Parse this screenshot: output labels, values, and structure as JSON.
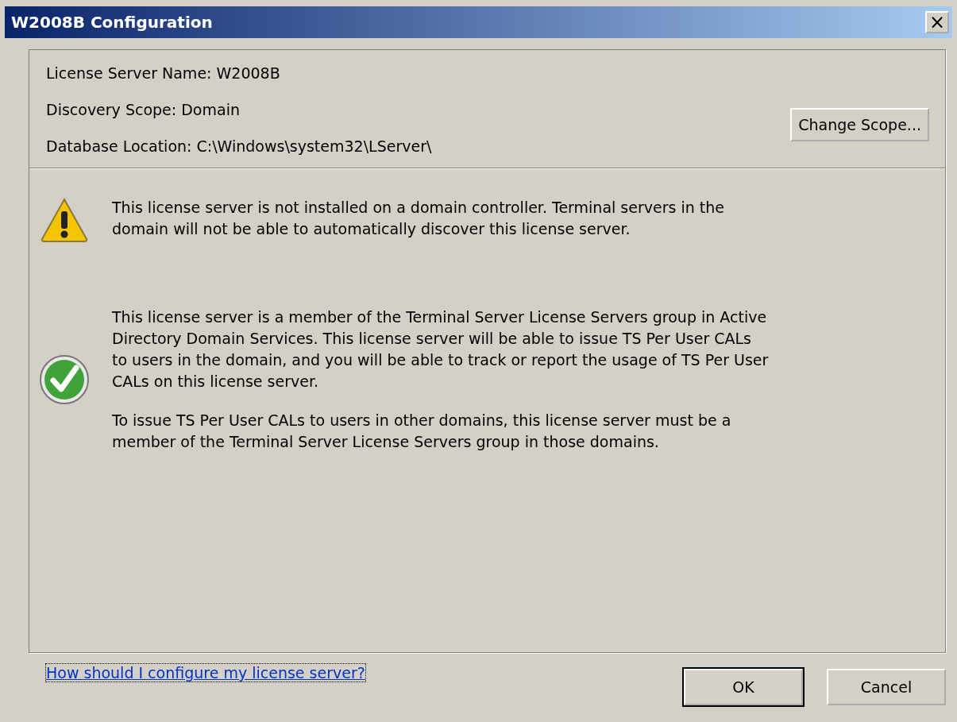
{
  "window": {
    "title": "W2008B Configuration",
    "close": "×"
  },
  "info": [
    {
      "text": "License Server Name: W2008B"
    },
    {
      "text": "Discovery Scope: Domain"
    },
    {
      "text": "Database Location: C:\\Windows\\system32\\LServer\\"
    }
  ],
  "change_scope_button": "Change Scope...",
  "messages": [
    {
      "kind": "warning",
      "paragraphs": [
        "This license server is not installed on a domain controller. Terminal servers in the domain will not be able to automatically discover this license server."
      ]
    },
    {
      "kind": "success",
      "paragraphs": [
        "This license server is a member of the Terminal Server License Servers group in Active Directory Domain Services. This license server will be able to issue TS Per User CALs to users in the domain, and you will be able to track or report the usage of TS Per User CALs on this license server.",
        "To issue TS Per User CALs to users in other domains, this license server must be a member of the Terminal Server License Servers group in those domains."
      ]
    }
  ],
  "help_link": "How should I configure my license server?",
  "buttons": [
    {
      "label": "OK",
      "default": true
    },
    {
      "label": "Cancel",
      "default": false
    }
  ]
}
